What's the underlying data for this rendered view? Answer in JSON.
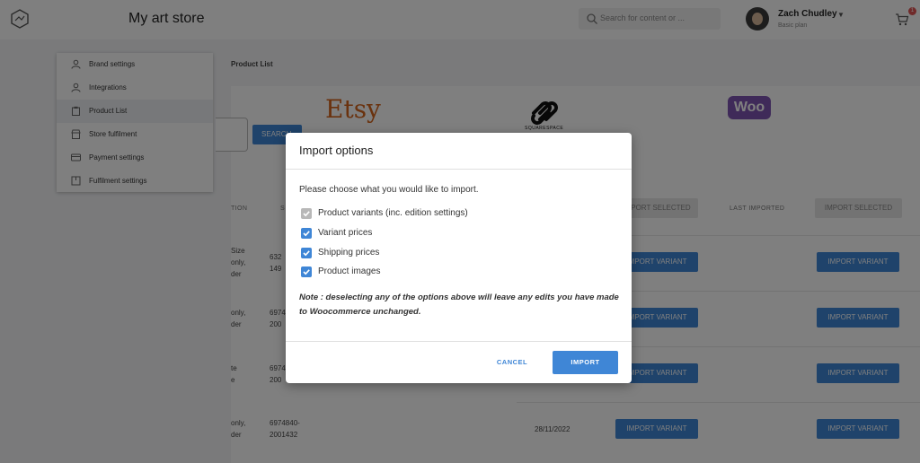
{
  "header": {
    "store_title": "My art store",
    "search_placeholder": "Search for content or ...",
    "user_name": "Zach Chudley",
    "user_plan": "Basic plan",
    "cart_count": "1"
  },
  "sidebar": {
    "items": [
      {
        "label": "Brand settings",
        "icon": "user-icon"
      },
      {
        "label": "Integrations",
        "icon": "user-icon"
      },
      {
        "label": "Product List",
        "icon": "clipboard-icon"
      },
      {
        "label": "Store fulfilment",
        "icon": "shop-icon"
      },
      {
        "label": "Payment settings",
        "icon": "card-icon"
      },
      {
        "label": "Fulfilment settings",
        "icon": "box-icon"
      }
    ],
    "active_index": 2
  },
  "breadcrumb": "Product List",
  "content": {
    "search_button": "SEARCH",
    "brands": {
      "etsy": "Etsy",
      "squarespace": "SQUARESPACE",
      "woo": "Woo"
    },
    "col_partial_desc": "TION",
    "col_partial_sku": "S",
    "last_imported": "LAST IMPORTED",
    "import_selected": "IMPORT SELECTED",
    "import_variant": "IMPORT VARIANT",
    "rows": [
      {
        "desc": [
          "Size",
          "only,",
          "der"
        ],
        "sku": [
          "632",
          "149"
        ]
      },
      {
        "desc": [
          "only,",
          "der"
        ],
        "sku": [
          "6974",
          "200"
        ]
      },
      {
        "desc": [
          "te",
          "e"
        ],
        "sku": [
          "6974",
          "200"
        ]
      },
      {
        "desc": [
          "only,",
          "der"
        ],
        "sku": [
          "6974840-",
          "2001432"
        ],
        "date": "28/11/2022"
      }
    ]
  },
  "modal": {
    "title": "Import options",
    "prompt": "Please choose what you would like to import.",
    "options": [
      {
        "label": "Product variants (inc. edition settings)",
        "checked": true,
        "disabled": true
      },
      {
        "label": "Variant prices",
        "checked": true,
        "disabled": false
      },
      {
        "label": "Shipping prices",
        "checked": true,
        "disabled": false
      },
      {
        "label": "Product images",
        "checked": true,
        "disabled": false
      }
    ],
    "note": "Note : deselecting any of the options above will leave any edits you have made to Woocommerce unchanged.",
    "cancel": "CANCEL",
    "import": "IMPORT"
  },
  "colors": {
    "accent": "#3f86d6",
    "etsy": "#d5641c",
    "woo": "#7f54b3",
    "badge": "#e05555"
  }
}
